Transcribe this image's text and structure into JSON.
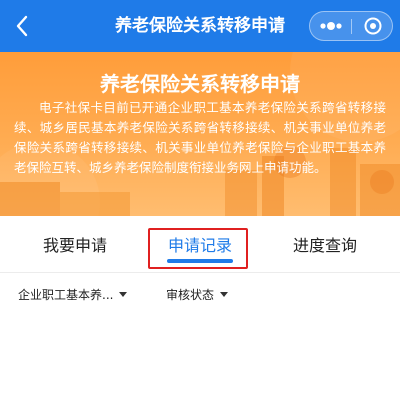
{
  "navbar": {
    "title": "养老保险关系转移申请",
    "back_icon": "back-arrow-icon",
    "more_icon": "more-dots-icon",
    "close_icon": "mini-program-close-icon",
    "color": "#1f7be8"
  },
  "banner": {
    "title": "养老保险关系转移申请",
    "description": "电子社保卡目前已开通企业职工基本养老保险关系跨省转移接续、城乡居民基本养老保险关系跨省转移接续、机关事业单位养老保险关系跨省转移接续、机关事业单位养老保险与企业职工基本养老保险互转、城乡养老保险制度衔接业务网上申请功能。",
    "color": "#ff9d3a"
  },
  "tabs": [
    {
      "label": "我要申请",
      "active": false
    },
    {
      "label": "申请记录",
      "active": true
    },
    {
      "label": "进度查询",
      "active": false
    }
  ],
  "filters": [
    {
      "label": "企业职工基本养...",
      "icon": "caret-down-icon"
    },
    {
      "label": "审核状态",
      "icon": "caret-down-icon"
    }
  ],
  "highlight_color": "#e02020"
}
